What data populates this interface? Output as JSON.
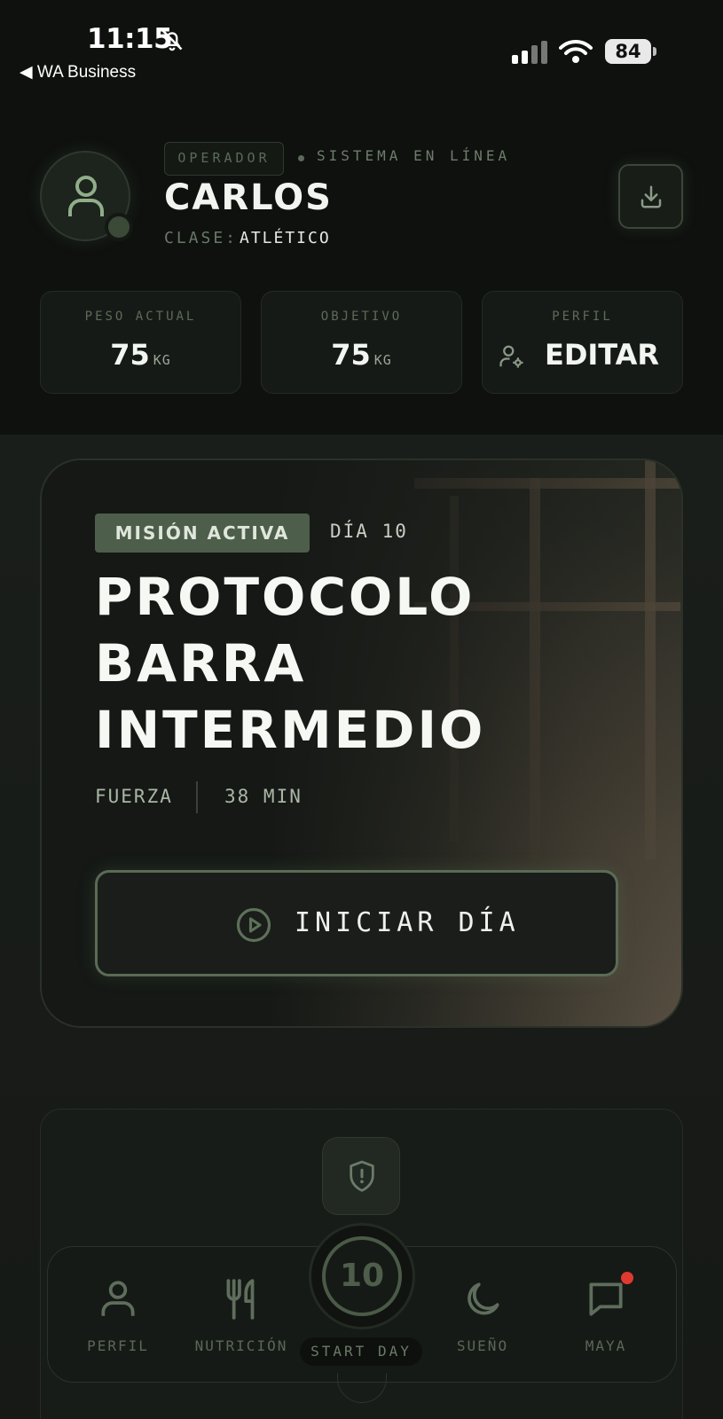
{
  "status_bar": {
    "time": "11:15",
    "back_app": "◀ WA Business",
    "battery": "84"
  },
  "profile": {
    "role_tag": "OPERADOR",
    "status": "SISTEMA EN LÍNEA",
    "name": "CARLOS",
    "class_label": "CLASE:",
    "class_value": "ATLÉTICO"
  },
  "stats": [
    {
      "label": "PESO ACTUAL",
      "value": "75",
      "unit": "KG"
    },
    {
      "label": "OBJETIVO",
      "value": "75",
      "unit": "KG"
    },
    {
      "label": "PERFIL",
      "value": "EDITAR"
    }
  ],
  "mission": {
    "badge": "MISIÓN ACTIVA",
    "day": "DÍA 10",
    "title_lines": [
      "PROTOCOLO",
      "BARRA",
      "INTERMEDIO"
    ],
    "category": "FUERZA",
    "duration": "38 MIN",
    "start_label": "INICIAR DÍA"
  },
  "nav": {
    "items": [
      {
        "label": "PERFIL",
        "icon": "user-icon"
      },
      {
        "label": "NUTRICIÓN",
        "icon": "fork-knife-icon"
      },
      {
        "label": "SUEÑO",
        "icon": "moon-icon"
      },
      {
        "label": "MAYA",
        "icon": "chat-icon"
      }
    ],
    "center_day": "10",
    "center_label": "START DAY"
  },
  "colors": {
    "accent": "#4d5e4a",
    "background": "#101210",
    "notification": "#e0392f"
  }
}
